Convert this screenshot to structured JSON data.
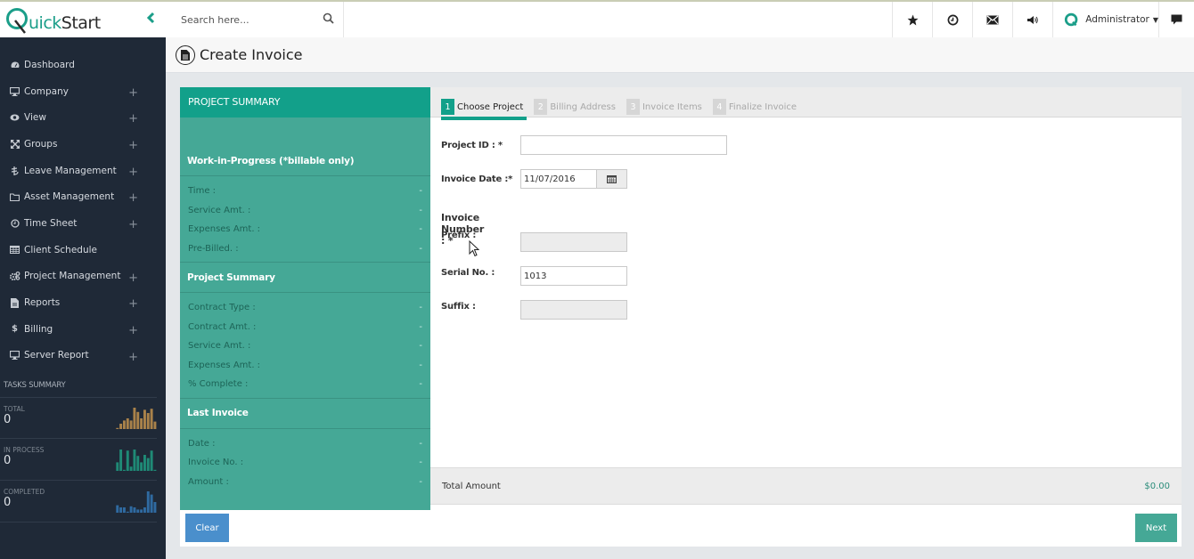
{
  "app": {
    "logo_letter": "Q",
    "logo_text_colored": "uick",
    "logo_text_dark": "Start",
    "brand_color": "#1b9e89"
  },
  "topbar": {
    "search_placeholder": "Search here...",
    "icons": [
      "star-icon",
      "clock-icon",
      "envelope-icon",
      "volume-icon"
    ],
    "user_name": "Administrator"
  },
  "sidebar": {
    "items": [
      {
        "label": "Dashboard",
        "icon": "dashboard-icon",
        "expandable": false
      },
      {
        "label": "Company",
        "icon": "desktop-icon",
        "expandable": true
      },
      {
        "label": "View",
        "icon": "eye-icon",
        "expandable": true
      },
      {
        "label": "Groups",
        "icon": "expand-icon",
        "expandable": true
      },
      {
        "label": "Leave Management",
        "icon": "leave-icon",
        "expandable": true
      },
      {
        "label": "Asset Management",
        "icon": "folder-icon",
        "expandable": true
      },
      {
        "label": "Time Sheet",
        "icon": "clock-icon",
        "expandable": true
      },
      {
        "label": "Client Schedule",
        "icon": "table-icon",
        "expandable": false
      },
      {
        "label": "Project Management",
        "icon": "cogs-icon",
        "expandable": true
      },
      {
        "label": "Reports",
        "icon": "file-icon",
        "expandable": true
      },
      {
        "label": "Billing",
        "icon": "dollar-icon",
        "expandable": true
      },
      {
        "label": "Server Report",
        "icon": "desktop-icon",
        "expandable": true
      }
    ],
    "plus_glyph": "+",
    "tasks_title": "TASKS SUMMARY",
    "tasks": [
      {
        "label": "TOTAL",
        "value": "0",
        "color": "#a9824a",
        "bars": [
          0.05,
          0.25,
          0.4,
          0.5,
          0.4,
          1.0,
          0.8,
          0.5,
          0.9,
          0.75,
          0.95,
          0.35
        ]
      },
      {
        "label": "IN PROCESS",
        "value": "0",
        "color": "#1f8a76",
        "bars": [
          0.4,
          1.0,
          0.05,
          0.95,
          0.2,
          1.0,
          0.7,
          0.4,
          0.75,
          0.6,
          0.95,
          0.05
        ]
      },
      {
        "label": "COMPLETED",
        "value": "0",
        "color": "#2f6aa1",
        "bars": [
          0.35,
          0.25,
          0.25,
          0.05,
          0.3,
          0.25,
          0.15,
          0.15,
          0.25,
          1.0,
          0.85,
          0.5
        ]
      }
    ]
  },
  "page": {
    "title": "Create Invoice"
  },
  "summary": {
    "header": "PROJECT SUMMARY",
    "sections": [
      {
        "title": "Work-in-Progress (*billable only)",
        "rows": [
          {
            "label": "Time :",
            "value": "-"
          },
          {
            "label": "Service Amt. :",
            "value": "-"
          },
          {
            "label": "Expenses Amt. :",
            "value": "-"
          },
          {
            "label": "Pre-Billed. :",
            "value": "-"
          }
        ]
      },
      {
        "title": "Project Summary",
        "rows": [
          {
            "label": "Contract Type :",
            "value": "-"
          },
          {
            "label": "Contract Amt. :",
            "value": "-"
          },
          {
            "label": "Service Amt. :",
            "value": "-"
          },
          {
            "label": "Expenses Amt. :",
            "value": "-"
          },
          {
            "label": "% Complete :",
            "value": "-"
          }
        ]
      },
      {
        "title": "Last Invoice",
        "rows": [
          {
            "label": "Date :",
            "value": "-"
          },
          {
            "label": "Invoice No. :",
            "value": "-"
          },
          {
            "label": "Amount :",
            "value": "-"
          }
        ]
      }
    ]
  },
  "wizard": {
    "steps": [
      {
        "num": "1",
        "label": "Choose Project",
        "active": true
      },
      {
        "num": "2",
        "label": "Billing Address",
        "active": false
      },
      {
        "num": "3",
        "label": "Invoice Items",
        "active": false
      },
      {
        "num": "4",
        "label": "Finalize Invoice",
        "active": false
      }
    ]
  },
  "form": {
    "project_id_label": "Project ID : *",
    "project_id_value": "",
    "invoice_date_label": "Invoice Date :*",
    "invoice_date_value": "11/07/2016",
    "invoice_number_title": "Invoice Number : *",
    "prefix_label": "Prefix :",
    "prefix_value": "",
    "serial_label": "Serial No. :",
    "serial_value": "1013",
    "suffix_label": "Suffix :",
    "suffix_value": ""
  },
  "totals": {
    "label": "Total Amount",
    "value": "$0.00"
  },
  "buttons": {
    "clear": "Clear",
    "next": "Next"
  }
}
